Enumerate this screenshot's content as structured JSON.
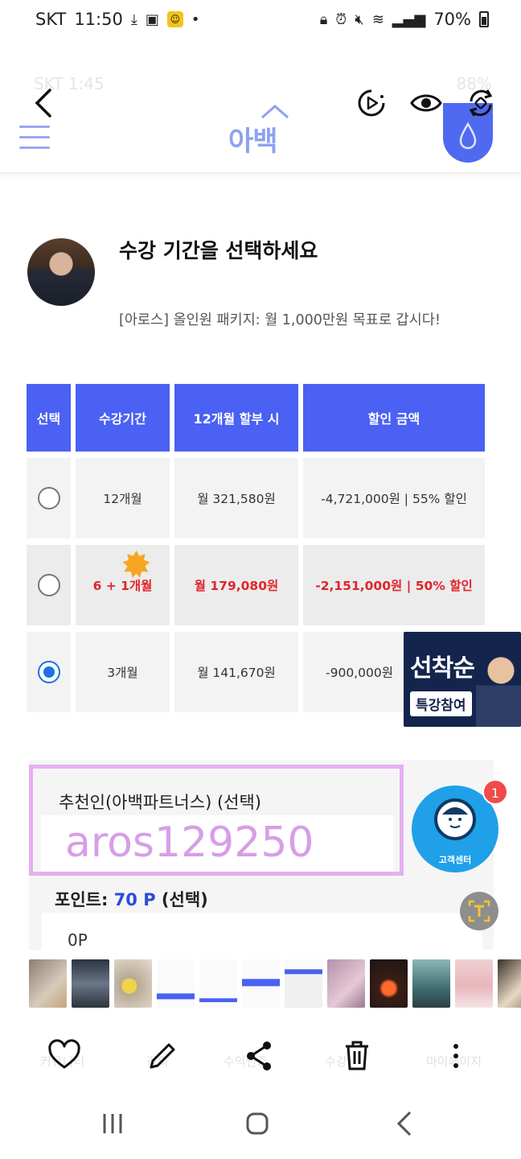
{
  "status_bar": {
    "carrier": "SKT",
    "time": "11:50",
    "battery": "70%"
  },
  "ghost_status": {
    "carrier": "SKT",
    "time": "1:45",
    "battery": "88%"
  },
  "site": {
    "logo": "아백"
  },
  "intro": {
    "title": "수강 기간을 선택하세요",
    "subtitle": "[아로스] 올인원 패키지: 월 1,000만원 목표로 갑시다!"
  },
  "table": {
    "headers": [
      "선택",
      "수강기간",
      "12개월 할부 시",
      "할인 금액"
    ],
    "rows": [
      {
        "period": "12개월",
        "monthly": "월 321,580원",
        "discount": "-4,721,000원 | 55% 할인",
        "selected": false,
        "highlight": false
      },
      {
        "period": "6 + 1개월",
        "monthly": "월 179,080원",
        "discount": "-2,151,000원 | 50% 할인",
        "selected": false,
        "highlight": true
      },
      {
        "period": "3개월",
        "monthly": "월 141,670원",
        "discount": "-900,000원",
        "selected": true,
        "highlight": false
      }
    ]
  },
  "first_come": {
    "title": "선착순",
    "pill": "특강참여"
  },
  "referrer": {
    "label": "추천인(아백파트너스) (선택)",
    "value": "aros129250"
  },
  "points": {
    "label_prefix": "포인트: ",
    "amount": "70 P",
    "label_suffix": " (선택)",
    "value": "0P"
  },
  "support": {
    "label": "고객센터",
    "count": "1"
  },
  "ghost_nav": [
    "커뮤니티",
    "강의",
    "수익인증",
    "수강",
    "마이페이지"
  ],
  "colors": {
    "accent": "#4a61f3",
    "highlight_text": "#e0252b",
    "referrer_border": "#e4b0f0",
    "support": "#1fa0e8"
  }
}
